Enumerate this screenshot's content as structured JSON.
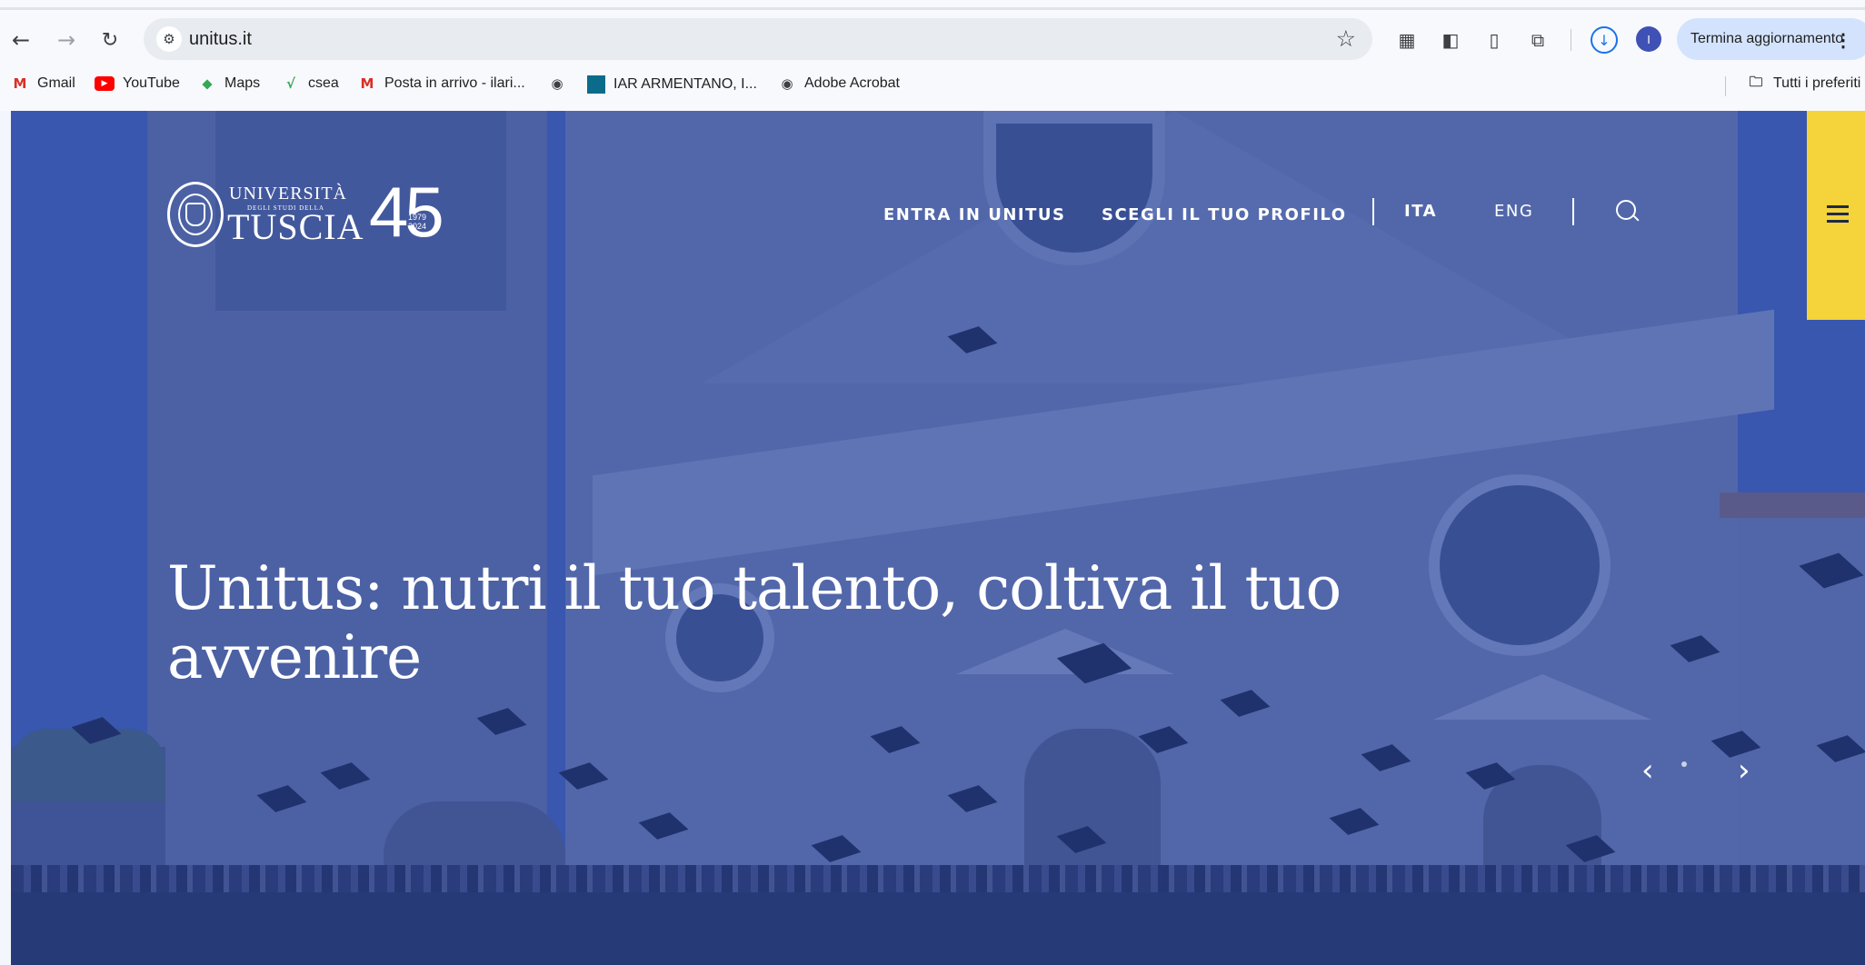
{
  "browser": {
    "url": "unitus.it",
    "update_button": "Termina aggiornamento",
    "bookmarks": [
      {
        "label": "Gmail",
        "icon": "gmail-icon"
      },
      {
        "label": "YouTube",
        "icon": "youtube-icon"
      },
      {
        "label": "Maps",
        "icon": "maps-icon"
      },
      {
        "label": "csea",
        "icon": "csea-icon"
      },
      {
        "label": "Posta in arrivo - ilari...",
        "icon": "gmail-icon"
      },
      {
        "label": "",
        "icon": "globe-icon"
      },
      {
        "label": "IAR ARMENTANO, I...",
        "icon": "square-icon"
      },
      {
        "label": "Adobe Acrobat",
        "icon": "globe-icon"
      }
    ],
    "bookmarks_folder": "Tutti i preferiti",
    "profile_initial": "I"
  },
  "site": {
    "logo": {
      "line1": "UNIVERSITÀ",
      "line2": "DEGLI STUDI DELLA",
      "line3": "TUSCIA",
      "anniversary": "45",
      "years_start": "1979",
      "years_end": "2024"
    },
    "nav": {
      "enter": "ENTRA IN UNITUS",
      "profile": "SCEGLI IL TUO PROFILO",
      "lang_ita": "ITA",
      "lang_eng": "ENG"
    },
    "hero": {
      "headline": "Unitus: nutri il tuo talento, coltiva il tuo avvenire"
    }
  },
  "colors": {
    "overlay": "#2b48af",
    "menu_tab": "#f4d33b",
    "update_button": "#d3e3fd",
    "download_accent": "#1a73e8"
  }
}
